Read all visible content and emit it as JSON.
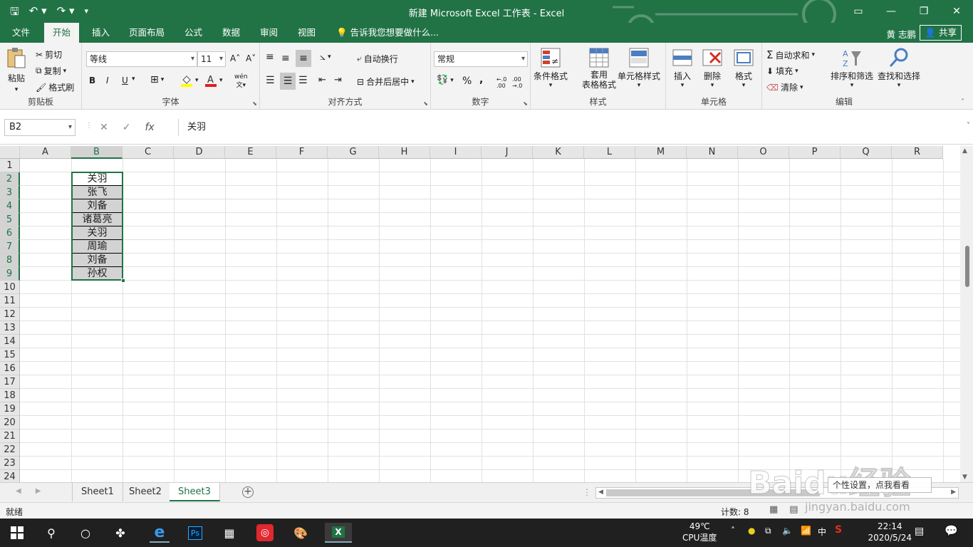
{
  "titlebar": {
    "title": "新建 Microsoft Excel 工作表 - Excel",
    "qat_save": "🖫",
    "qat_undo": "↶ ▾",
    "qat_redo": "↷ ▾",
    "qat_more": "▾",
    "win_ribbon": "▭",
    "win_min": "—",
    "win_max": "❐",
    "win_close": "✕"
  },
  "tabs": {
    "file": "文件",
    "home": "开始",
    "insert": "插入",
    "layout": "页面布局",
    "formulas": "公式",
    "data": "数据",
    "review": "审阅",
    "view": "视图",
    "tellme": "告诉我您想要做什么...",
    "user": "黄 志鹏",
    "share": "共享"
  },
  "ribbon": {
    "clipboard": {
      "label": "剪贴板",
      "paste": "粘贴",
      "cut": "剪切",
      "copy": "复制",
      "painter": "格式刷"
    },
    "font": {
      "label": "字体",
      "name": "等线",
      "size": "11",
      "grow": "A˄",
      "shrink": "A˅",
      "bold": "B",
      "italic": "I",
      "underline": "U",
      "wen": "wén"
    },
    "align": {
      "label": "对齐方式",
      "wrap": "自动换行",
      "merge": "合并后居中"
    },
    "number": {
      "label": "数字",
      "format": "常规",
      "percent": "%",
      "comma": ","
    },
    "styles": {
      "label": "样式",
      "cond": "条件格式",
      "table_1": "套用",
      "table_2": "表格格式",
      "cell": "单元格样式"
    },
    "cells": {
      "label": "单元格",
      "insert": "插入",
      "delete": "删除",
      "format": "格式"
    },
    "editing": {
      "label": "编辑",
      "autosum": "自动求和",
      "fill": "填充",
      "clear": "清除",
      "sort": "排序和筛选",
      "find": "查找和选择"
    }
  },
  "formula_bar": {
    "name_box": "B2",
    "cancel": "✕",
    "enter": "✓",
    "fx": "fx",
    "content": "关羽"
  },
  "grid": {
    "columns": [
      "A",
      "B",
      "C",
      "D",
      "E",
      "F",
      "G",
      "H",
      "I",
      "J",
      "K",
      "L",
      "M",
      "N",
      "O",
      "P",
      "Q",
      "R"
    ],
    "rows": [
      "1",
      "2",
      "3",
      "4",
      "5",
      "6",
      "7",
      "8",
      "9",
      "10",
      "11",
      "12",
      "13",
      "14",
      "15",
      "16",
      "17",
      "18",
      "19",
      "20",
      "21",
      "22",
      "23",
      "24"
    ],
    "selected_column": "B",
    "b_values": [
      "关羽",
      "张飞",
      "刘备",
      "诸葛亮",
      "关羽",
      "周瑜",
      "刘备",
      "孙权"
    ]
  },
  "sheets": {
    "tab1": "Sheet1",
    "tab2": "Sheet2",
    "tab3": "Sheet3",
    "active": "Sheet3",
    "add": "+"
  },
  "status": {
    "ready": "就绪",
    "count": "计数: 8"
  },
  "watermark": {
    "logo": "Baidu经验",
    "sub": "jingyan.baidu.com",
    "box": "个性设置，点我看看"
  },
  "taskbar": {
    "temp": "49℃",
    "temp_label": "CPU温度",
    "ime": "中",
    "time": "22:14",
    "date": "2020/5/24"
  }
}
